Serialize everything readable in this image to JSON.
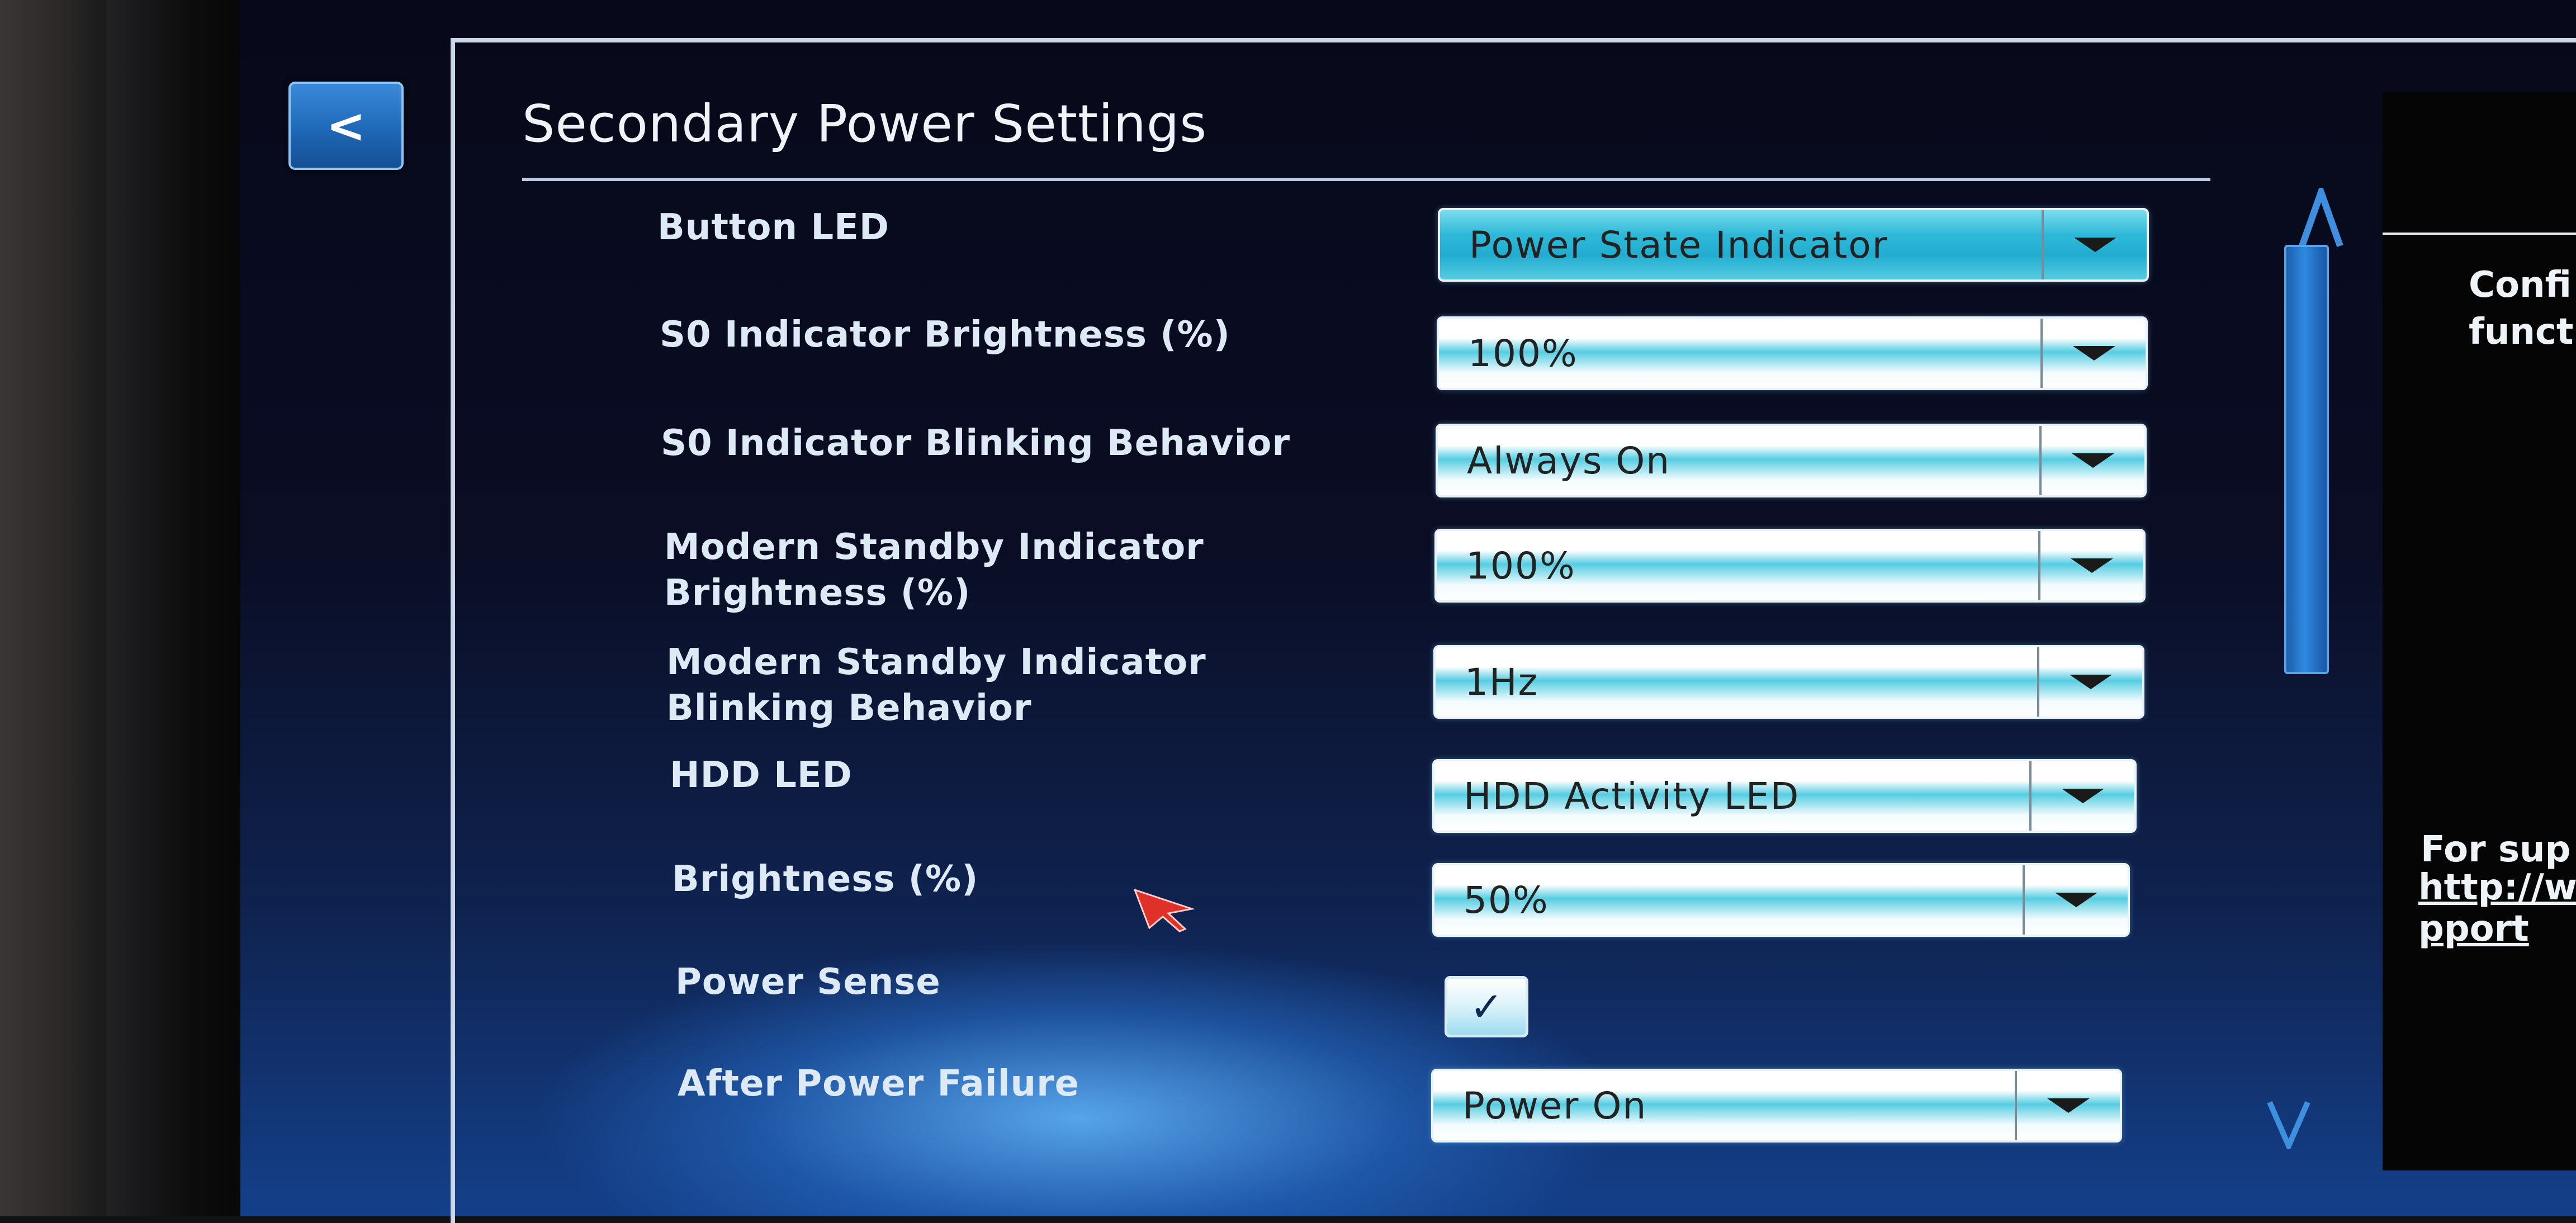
{
  "header": {
    "back_label": "<",
    "title": "Secondary Power Settings"
  },
  "settings": [
    {
      "label": "Button LED",
      "value": "Power State Indicator",
      "control": "dropdown",
      "active": true
    },
    {
      "label": "S0 Indicator Brightness (%)",
      "value": "100%",
      "control": "dropdown"
    },
    {
      "label": "S0 Indicator Blinking Behavior",
      "value": "Always On",
      "control": "dropdown"
    },
    {
      "label": "Modern Standby Indicator Brightness (%)",
      "label_lines": [
        "Modern Standby Indicator",
        "Brightness (%)"
      ],
      "value": "100%",
      "control": "dropdown"
    },
    {
      "label": "Modern Standby Indicator Blinking Behavior",
      "label_lines": [
        "Modern Standby Indicator",
        "Blinking Behavior"
      ],
      "value": "1Hz",
      "control": "dropdown"
    },
    {
      "label": "HDD LED",
      "value": "HDD Activity LED",
      "control": "dropdown"
    },
    {
      "label": "Brightness (%)",
      "value": "50%",
      "control": "dropdown"
    },
    {
      "label": "Power Sense",
      "checked": true,
      "check_glyph": "✓",
      "control": "checkbox"
    },
    {
      "label": "After Power Failure",
      "value": "Power On",
      "control": "dropdown"
    }
  ],
  "help_panel": {
    "line1": "Confi",
    "line2": "funct",
    "support_line": "For sup",
    "link_line1": "http://w",
    "link_line2": "pport"
  },
  "scrollbar": {
    "up_glyph": "Λ",
    "down_glyph": "V"
  },
  "colors": {
    "accent": "#2fb9d8",
    "back_button": "#1f68b8",
    "scroll_thumb": "#2e8ae0",
    "label_text": "#ddeaf6",
    "cursor": "#e0302a"
  }
}
